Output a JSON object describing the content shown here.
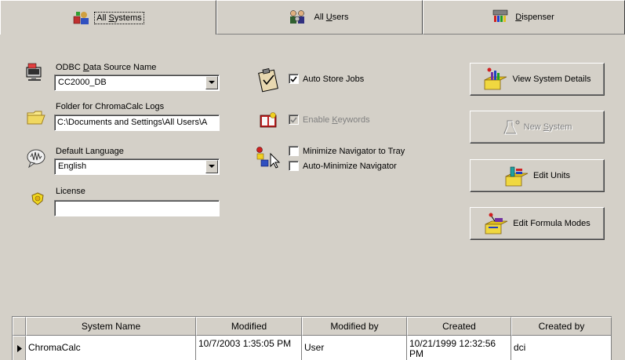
{
  "tabs": [
    {
      "label_pre": "All ",
      "label_u": "S",
      "label_post": "ystems",
      "icon": "systems-icon",
      "active": true
    },
    {
      "label_pre": "All ",
      "label_u": "U",
      "label_post": "sers",
      "icon": "users-icon",
      "active": false
    },
    {
      "label_pre": "",
      "label_u": "D",
      "label_post": "ispenser",
      "icon": "dispenser-icon",
      "active": false
    }
  ],
  "odbc": {
    "label_pre": "ODBC ",
    "label_u": "D",
    "label_post": "ata Source Name",
    "value": "CC2000_DB",
    "icon": "database-icon"
  },
  "logs_folder": {
    "label": "Folder for ChromaCalc Logs",
    "value": "C:\\Documents and Settings\\All Users\\A",
    "icon": "folder-icon"
  },
  "language": {
    "label": "Default Language",
    "value": "English",
    "icon": "speech-icon"
  },
  "license": {
    "label": "License",
    "value": "",
    "icon": "license-icon"
  },
  "options": {
    "auto_store_jobs": {
      "label": "Auto Store Jobs",
      "checked": true,
      "enabled": true
    },
    "enable_keywords": {
      "label_pre": "Enable ",
      "label_u": "K",
      "label_post": "eywords",
      "checked": true,
      "enabled": false
    },
    "minimize_to_tray": {
      "label": "Minimize Navigator to Tray",
      "checked": false,
      "enabled": true
    },
    "auto_minimize": {
      "label": "Auto-Minimize Navigator",
      "checked": false,
      "enabled": true
    }
  },
  "buttons": {
    "view_system_details": "View System Details",
    "new_system_pre": "New ",
    "new_system_u": "S",
    "new_system_post": "ystem",
    "edit_units": "Edit Units",
    "edit_formula_modes": "Edit Formula Modes"
  },
  "table": {
    "columns": [
      "System Name",
      "Modified",
      "Modified by",
      "Created",
      "Created by"
    ],
    "rows": [
      {
        "system_name": "ChromaCalc",
        "modified": "10/7/2003 1:35:05 PM",
        "modified_by": "User",
        "created": "10/21/1999 12:32:56 PM",
        "created_by": "dci"
      }
    ]
  }
}
